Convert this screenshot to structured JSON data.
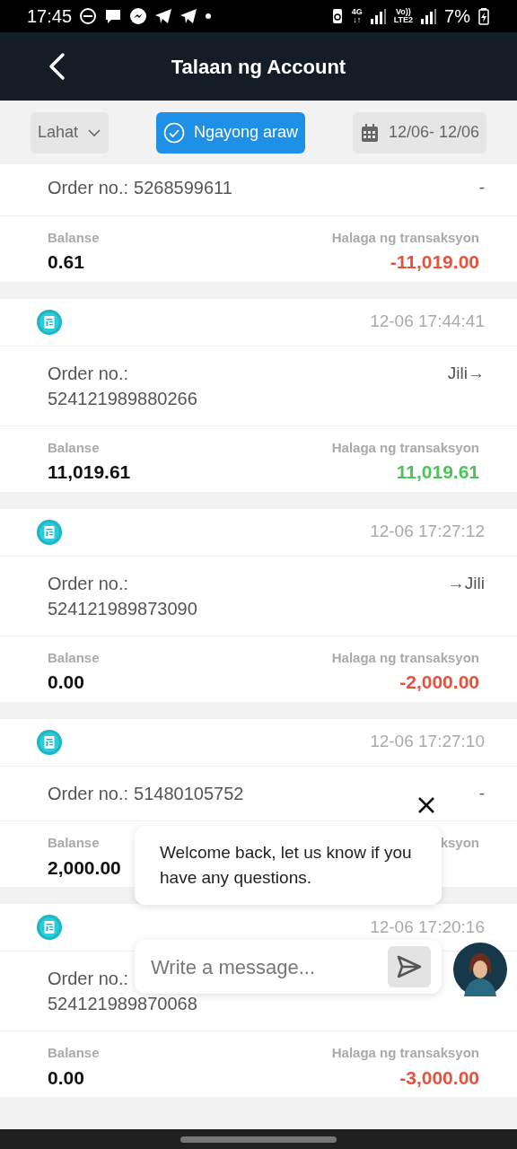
{
  "status_bar": {
    "time": "17:45",
    "network": [
      {
        "top": "4G",
        "bottom": "↓↑"
      },
      {
        "top": "Vo))",
        "bottom": "LTE2"
      }
    ],
    "battery": "7%"
  },
  "header": {
    "title": "Talaan ng Account"
  },
  "filters": [
    {
      "kind": "dropdown",
      "label": "Lahat",
      "selected": false
    },
    {
      "kind": "toggle",
      "label": "Ngayong araw",
      "selected": true
    },
    {
      "kind": "date",
      "label": "12/06- 12/06",
      "selected": false
    }
  ],
  "records": [
    {
      "order_label": "Order no.:",
      "order_no": "5268599611",
      "direction": "-",
      "balance_label": "Balanse",
      "balance": "0.61",
      "amount_label": "Halaga ng transaksyon",
      "amount": "-11,019.00",
      "color": "#e5533d"
    },
    {
      "time": "12-06 17:44:41",
      "order_label": "Order no.:",
      "order_no": "524121989880266",
      "direction": "Jili→",
      "balance_label": "Balanse",
      "balance": "11,019.61",
      "amount_label": "Halaga ng transaksyon",
      "amount": "11,019.61",
      "color": "#4cc35a"
    },
    {
      "time": "12-06 17:27:12",
      "order_label": "Order no.:",
      "order_no": "524121989873090",
      "direction": "→Jili",
      "balance_label": "Balanse",
      "balance": "0.00",
      "amount_label": "Halaga ng transaksyon",
      "amount": "-2,000.00",
      "color": "#e5533d"
    },
    {
      "time": "12-06 17:27:10",
      "order_label": "Order no.:",
      "order_no": "51480105752",
      "direction": "-",
      "balance_label": "Balanse",
      "balance": "2,000.00",
      "amount_label": "ksyon"
    },
    {
      "time": "12-06 17:20:16",
      "order_label": "Order no.:",
      "order_no": "524121989870068",
      "balance_label": "Balanse",
      "balance": "0.00",
      "amount_label": "Halaga ng transaksyon",
      "amount": "-3,000.00",
      "color": "#e5533d"
    }
  ],
  "chat": {
    "message": "Welcome back, let us know if you have any questions.",
    "placeholder": "Write a message..."
  }
}
